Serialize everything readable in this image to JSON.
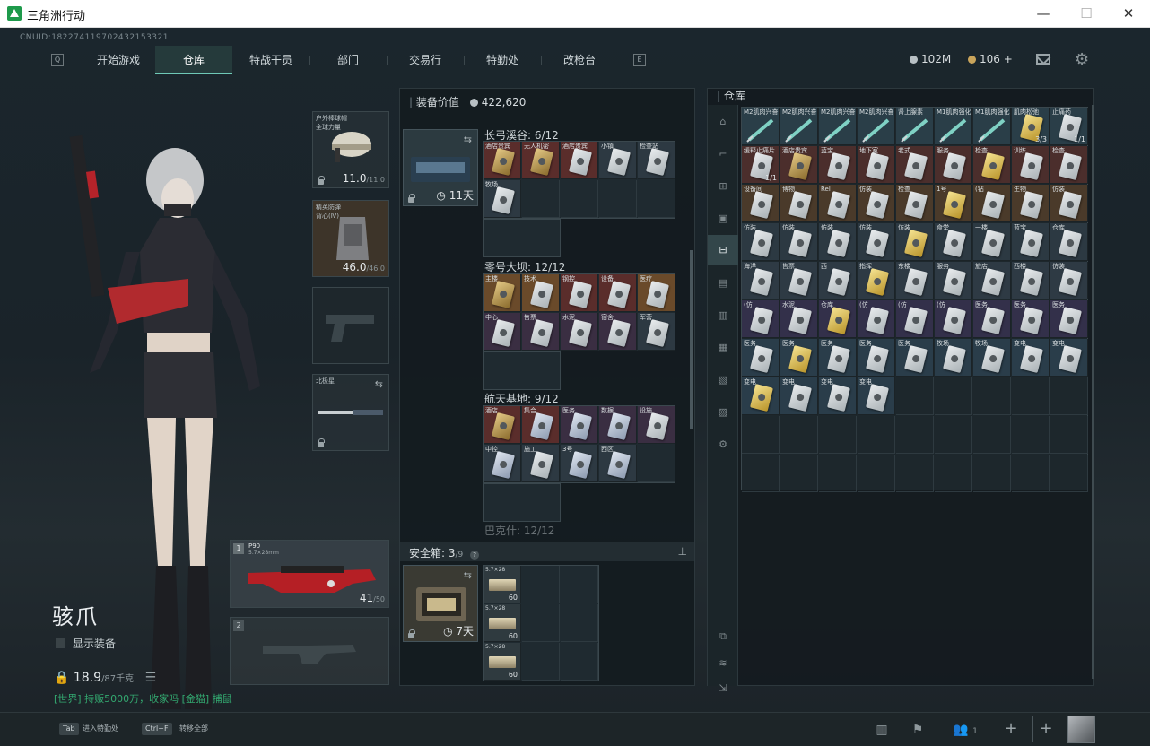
{
  "window": {
    "title": "三角洲行动",
    "minimize": "—",
    "maximize": "☐",
    "close": "✕"
  },
  "uid": "CNUID:182274119702432153321",
  "nav": {
    "left_key": "Q",
    "right_key": "E",
    "tabs": [
      "开始游戏",
      "仓库",
      "特战干员",
      "部门",
      "交易行",
      "特勤处",
      "改枪台"
    ],
    "active": "仓库"
  },
  "currency": {
    "silver": "102M",
    "gold": "106",
    "plus": "+"
  },
  "equipment": {
    "helmet": {
      "label": "户外棒球帽\n全球力量",
      "durability": "11.0",
      "max": "/11.0"
    },
    "armor": {
      "label": "精英防弹\n背心(Ⅳ)",
      "durability": "46.0",
      "max": "/46.0"
    },
    "melee": {
      "label": "北极星"
    },
    "primary": {
      "index": "1",
      "name": "P90",
      "caliber": "5.7×28mm",
      "ammo": "41",
      "ammo_max": "/50"
    },
    "secondary": {
      "index": "2"
    }
  },
  "operator": {
    "name": "骇爪",
    "show_gear": "显示装备",
    "weight": "18.9",
    "weight_max": "/87千克"
  },
  "chat": "[世界] 持贩5000万，收家吗 [金猫] 捕鼠",
  "middle": {
    "title": "装备价值",
    "value": "422,620",
    "container_time": "11天",
    "sections": [
      {
        "title": "长弓溪谷: 6/12"
      },
      {
        "title": "零号大坝: 12/12"
      },
      {
        "title": "航天基地: 9/12"
      },
      {
        "title": "巴克什: 12/12"
      }
    ],
    "safe_box": {
      "title": "安全箱:",
      "count": "3",
      "count_max": "/9",
      "time": "7天"
    },
    "ammo": [
      {
        "label": "5.7×28",
        "count": "60"
      },
      {
        "label": "5.7×28",
        "count": "60"
      },
      {
        "label": "5.7×28",
        "count": "60"
      }
    ]
  },
  "section_items": {
    "s1": [
      {
        "label": "酒店贵宾",
        "style": "gold",
        "bg": "#5a2d2b"
      },
      {
        "label": "无人机密",
        "style": "gold",
        "bg": "#5a2d2b"
      },
      {
        "label": "酒店贵宾",
        "style": "white",
        "bg": "#5a2d2b"
      },
      {
        "label": "小镇",
        "style": "white",
        "bg": "#2d3942"
      },
      {
        "label": "检查站",
        "style": "white",
        "bg": "#2d3942"
      },
      {
        "label": "牧场",
        "style": "white",
        "bg": "#2d3942"
      }
    ],
    "s2": [
      {
        "label": "主楼",
        "style": "gold",
        "bg": "#6a4a2a"
      },
      {
        "label": "技术",
        "style": "white",
        "bg": "#6a4a2a"
      },
      {
        "label": "钢控",
        "style": "white",
        "bg": "#5a2d2b"
      },
      {
        "label": "设备",
        "style": "white",
        "bg": "#5a2d2b"
      },
      {
        "label": "医疗",
        "style": "white",
        "bg": "#6a4a2a"
      },
      {
        "label": "中心",
        "style": "white",
        "bg": "#3a2e42"
      },
      {
        "label": "售票",
        "style": "white",
        "bg": "#3a2e42"
      },
      {
        "label": "水泥",
        "style": "white",
        "bg": "#3a2e42"
      },
      {
        "label": "宿舍",
        "style": "white",
        "bg": "#3a2e42"
      },
      {
        "label": "军营",
        "style": "white",
        "bg": "#2d3942"
      },
      {
        "label": "医务",
        "style": "white",
        "bg": "#2d3942"
      },
      {
        "label": "保卫",
        "style": "white",
        "bg": "#2d3942"
      }
    ],
    "s3": [
      {
        "label": "酒店",
        "style": "gold",
        "bg": "#5a2d2b"
      },
      {
        "label": "集合",
        "style": "blue",
        "bg": "#5a2d2b"
      },
      {
        "label": "医务",
        "style": "blue",
        "bg": "#3a2e42"
      },
      {
        "label": "数据",
        "style": "blue",
        "bg": "#3a2e42"
      },
      {
        "label": "设施",
        "style": "white",
        "bg": "#3a2e42"
      },
      {
        "label": "中控",
        "style": "blue",
        "bg": "#2d3942"
      },
      {
        "label": "施工",
        "style": "white",
        "bg": "#2d3942"
      },
      {
        "label": "3号",
        "style": "blue",
        "bg": "#2d3942"
      },
      {
        "label": "西区",
        "style": "blue",
        "bg": "#2d3942"
      }
    ]
  },
  "stash": {
    "title": "仓库",
    "rows": [
      [
        "M2肌肉兴奋",
        "M2肌肉兴奋",
        "M2肌肉兴奋",
        "M2肌肉兴奋",
        "肾上腺素",
        "M1肌肉强化",
        "M1肌肉强化",
        "肌肉松弛",
        "止痛药"
      ],
      [
        "缓释止痛片",
        "酒店贵宾",
        "蓝宝",
        "地下室",
        "老式",
        "服务",
        "检查",
        "训练",
        "检查"
      ],
      [
        "设备间",
        "博物",
        "Rel",
        "仿装",
        "检查",
        "1号",
        "(钻",
        "生物",
        "仿装"
      ],
      [
        "仿装",
        "仿装",
        "仿装",
        "仿装",
        "仿装",
        "食堂",
        "一楼",
        "蓝宝",
        "仓库"
      ],
      [
        "海洋",
        "售票",
        "西",
        "指挥",
        "东楼",
        "服务",
        "旅店",
        "西楼",
        "仿装"
      ],
      [
        "(仿",
        "水泥",
        "仓库",
        "(仿",
        "(仿",
        "(仿",
        "医务",
        "医务",
        "医务"
      ],
      [
        "医务",
        "医务",
        "医务",
        "医务",
        "医务",
        "牧场",
        "牧场",
        "变电",
        "变电"
      ],
      [
        "变电",
        "变电",
        "变电",
        "变电"
      ]
    ],
    "counts": {
      "0-7": "3/3",
      "0-8": "1/1",
      "1-0": "1/1"
    }
  },
  "bottom": {
    "tab_key": "Tab",
    "tab_label": "进入特勤处",
    "ctrl_key": "Ctrl+F",
    "ctrl_label": "转移全部",
    "players": "1",
    "plus": "+"
  },
  "colors": {
    "accent": "#6fc9b7",
    "chat_green": "#33a870"
  }
}
